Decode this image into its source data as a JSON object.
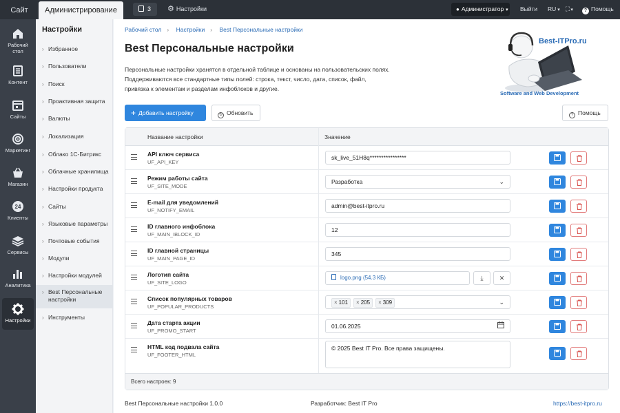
{
  "topbar": {
    "site_tab": "Сайт",
    "admin_tab": "Администрирование",
    "notifications_count": "3",
    "settings_label": "Настройки",
    "user_label": "Администратор",
    "exit_label": "Выйти",
    "lang_label": "RU",
    "help_label": "Помощь"
  },
  "leftnav": {
    "items": [
      {
        "label": "Рабочий стол",
        "icon": "home-icon"
      },
      {
        "label": "Контент",
        "icon": "content-icon"
      },
      {
        "label": "Сайты",
        "icon": "sites-icon"
      },
      {
        "label": "Маркетинг",
        "icon": "target-icon"
      },
      {
        "label": "Магазин",
        "icon": "basket-icon"
      },
      {
        "label": "Клиенты",
        "icon": "clients-24-icon",
        "badge": "24"
      },
      {
        "label": "Сервисы",
        "icon": "layers-icon"
      },
      {
        "label": "Аналитика",
        "icon": "bar-chart-icon"
      },
      {
        "label": "Настройки",
        "icon": "gear-icon"
      }
    ]
  },
  "sidebar": {
    "title": "Настройки",
    "items": [
      {
        "label": "Избранное"
      },
      {
        "label": "Пользователи"
      },
      {
        "label": "Поиск"
      },
      {
        "label": "Проактивная защита"
      },
      {
        "label": "Валюты"
      },
      {
        "label": "Локализация"
      },
      {
        "label": "Облако 1С-Битрикс"
      },
      {
        "label": "Облачные хранилища"
      },
      {
        "label": "Настройки продукта"
      },
      {
        "label": "Сайты"
      },
      {
        "label": "Языковые параметры"
      },
      {
        "label": "Почтовые события"
      },
      {
        "label": "Модули"
      },
      {
        "label": "Настройки модулей"
      },
      {
        "label": "Best Персональные настройки"
      },
      {
        "label": "Инструменты"
      }
    ]
  },
  "breadcrumb": [
    "Рабочий стол",
    "Настройки",
    "Best Персональные настройки"
  ],
  "page": {
    "title": "Best Персональные настройки",
    "description_lines": [
      "Персональные настройки хранятся в отдельной таблице и основаны на пользовательских полях.",
      "Поддерживаются все стандартные типы полей: строка, текст, число, дата, список, файл,",
      "привязка к элементам и разделам инфоблоков и другие."
    ],
    "add_button": "Добавить настройку",
    "refresh_button": "Обновить",
    "help_button": "Помощь"
  },
  "logo": {
    "name": "Best-ITPro.ru",
    "tagline": "Software and Web Development"
  },
  "table": {
    "col_name": "Название настройки",
    "col_value": "Значение",
    "rows": [
      {
        "name": "API ключ сервиса",
        "code": "UF_API_KEY",
        "value": "sk_live_51H8q****************"
      },
      {
        "name": "Режим работы сайта",
        "code": "UF_SITE_MODE",
        "value": "Разработка"
      },
      {
        "name": "E-mail для уведомлений",
        "code": "UF_NOTIFY_EMAIL",
        "value": "admin@best-itpro.ru"
      },
      {
        "name": "ID главного инфоблока",
        "code": "UF_MAIN_IBLOCK_ID",
        "value": "12"
      },
      {
        "name": "ID главной страницы",
        "code": "UF_MAIN_PAGE_ID",
        "value": "345"
      },
      {
        "name": "Логотип сайта",
        "code": "UF_SITE_LOGO",
        "value": "logo.png",
        "size": "(54.3 КБ)"
      },
      {
        "name": "Список популярных товаров",
        "code": "UF_POPULAR_PRODUCTS",
        "tags": [
          "101",
          "205",
          "309"
        ]
      },
      {
        "name": "Дата старта акции",
        "code": "UF_PROMO_START",
        "value": "01.06.2025"
      },
      {
        "name": "HTML код подвала сайта",
        "code": "UF_FOOTER_HTML",
        "value": "© 2025 Best IT Pro. Все права защищены."
      }
    ],
    "total": "Всего настроек: 9"
  },
  "footer": {
    "version": "Best Персональные настройки 1.0.0",
    "developer": "Разработчик: Best IT Pro",
    "url": "https://best-itpro.ru"
  },
  "colors": {
    "primary": "#2f86de",
    "danger": "#e27b7b",
    "topbar": "#2c3138",
    "leftnav": "#3a4049"
  }
}
